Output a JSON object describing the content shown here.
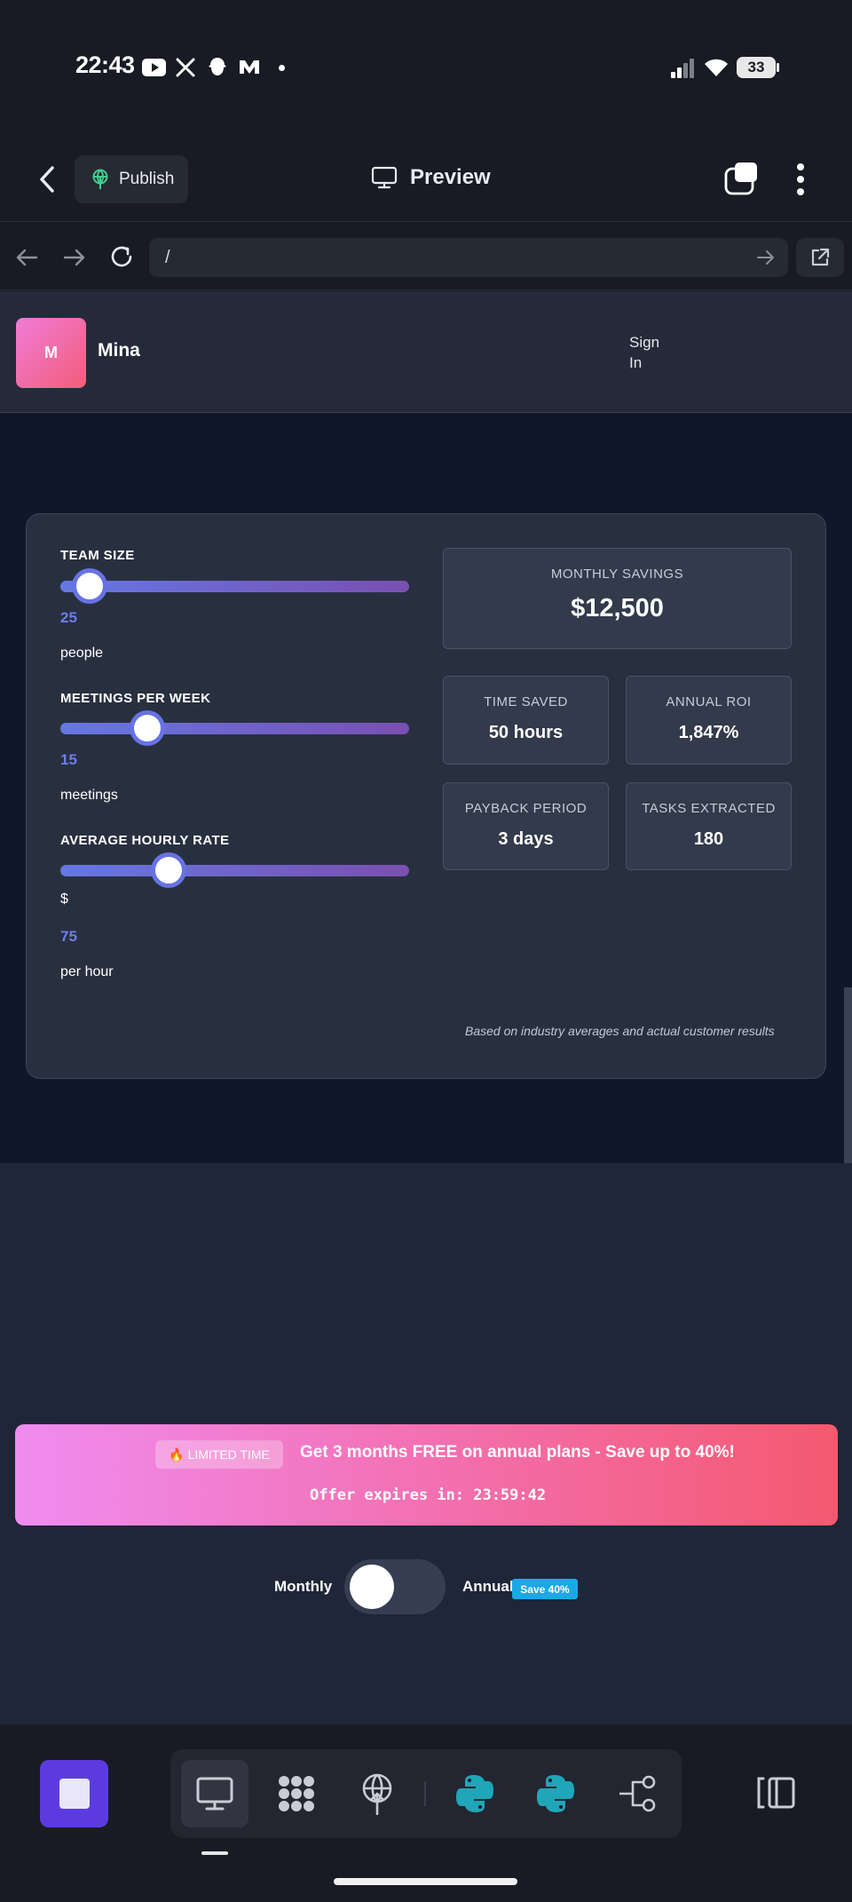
{
  "status_bar": {
    "time": "22:43",
    "battery": "33",
    "left_icons": [
      "youtube-icon",
      "x-icon",
      "bird-icon",
      "m-icon",
      "dot-icon"
    ],
    "right_icons": [
      "signal-icon",
      "wifi-icon",
      "battery-icon"
    ]
  },
  "app_header": {
    "publish_label": "Publish",
    "preview_label": "Preview"
  },
  "url_bar": {
    "url": "/"
  },
  "site_header": {
    "avatar_letter": "M",
    "brand_name": "Mina",
    "sign_in_label": "Sign In"
  },
  "calculator": {
    "sliders": [
      {
        "label": "TEAM SIZE",
        "value": "25",
        "prefix": "",
        "unit": "people",
        "level": 0.085
      },
      {
        "label": "MEETINGS PER WEEK",
        "value": "15",
        "prefix": "",
        "unit": "meetings",
        "level": 0.25
      },
      {
        "label": "AVERAGE HOURLY RATE",
        "value": "75",
        "prefix": "$",
        "unit": "per hour",
        "level": 0.31
      }
    ],
    "monthly_savings": {
      "label": "MONTHLY SAVINGS",
      "value": "$12,500"
    },
    "stats": [
      {
        "label": "TIME SAVED",
        "value": "50 hours"
      },
      {
        "label": "ANNUAL ROI",
        "value": "1,847%"
      },
      {
        "label": "PAYBACK PERIOD",
        "value": "3 days"
      },
      {
        "label": "TASKS EXTRACTED",
        "value": "180"
      }
    ],
    "disclaimer": "Based on industry averages and actual customer results"
  },
  "promo": {
    "badge_emoji": "🔥",
    "badge_label": "LIMITED TIME",
    "headline": "Get 3 months FREE on annual plans - Save up to 40%!",
    "countdown": "Offer expires in: 23:59:42"
  },
  "billing": {
    "monthly_label": "Monthly",
    "annual_label": "Annual",
    "save_badge": "Save 40%",
    "selected": "Monthly"
  },
  "toolbar": {
    "tools": [
      "desktop-icon",
      "grid-icon",
      "deploy-icon",
      "python-icon",
      "python-icon",
      "flow-icon"
    ],
    "active_tool": "desktop-icon",
    "colors": {
      "accent": "#5b3be0",
      "python": "#1fa6b8"
    }
  }
}
